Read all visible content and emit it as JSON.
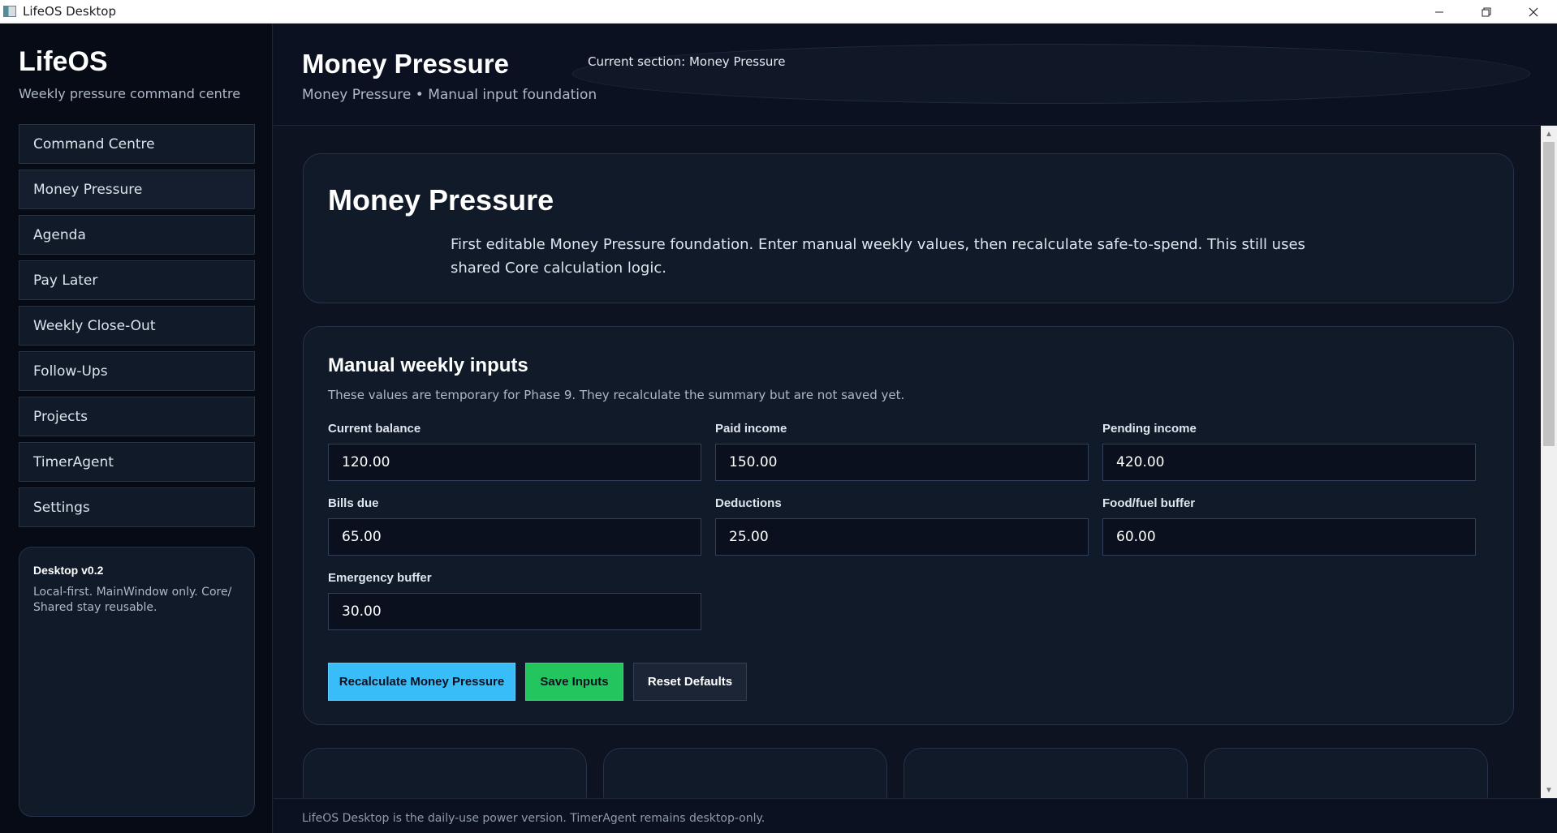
{
  "window": {
    "title": "LifeOS Desktop"
  },
  "sidebar": {
    "brand": "LifeOS",
    "tagline": "Weekly pressure command centre",
    "items": [
      {
        "label": "Command Centre"
      },
      {
        "label": "Money Pressure"
      },
      {
        "label": "Agenda"
      },
      {
        "label": "Pay Later"
      },
      {
        "label": "Weekly Close-Out"
      },
      {
        "label": "Follow-Ups"
      },
      {
        "label": "Projects"
      },
      {
        "label": "TimerAgent"
      },
      {
        "label": "Settings"
      }
    ],
    "active_item": "Money Pressure",
    "version": {
      "title": "Desktop v0.2",
      "text": "Local-first. MainWindow only. Core/ Shared stay reusable."
    }
  },
  "header": {
    "title": "Money Pressure",
    "subtitle": "Money Pressure • Manual input foundation",
    "current_section": "Current section: Money Pressure"
  },
  "hero": {
    "title": "Money Pressure",
    "description": "First editable Money Pressure foundation. Enter manual weekly values, then recalculate safe-to-spend. This still uses shared Core calculation logic."
  },
  "inputs": {
    "title": "Manual weekly inputs",
    "hint": "These values are temporary for Phase 9. They recalculate the summary but are not saved yet.",
    "fields": [
      {
        "label": "Current balance",
        "value": "120.00"
      },
      {
        "label": "Paid income",
        "value": "150.00"
      },
      {
        "label": "Pending income",
        "value": "420.00"
      },
      {
        "label": "Bills due",
        "value": "65.00"
      },
      {
        "label": "Deductions",
        "value": "25.00"
      },
      {
        "label": "Food/fuel buffer",
        "value": "60.00"
      },
      {
        "label": "Emergency buffer",
        "value": "30.00"
      }
    ],
    "buttons": {
      "recalculate": "Recalculate Money Pressure",
      "save": "Save Inputs",
      "reset": "Reset Defaults"
    }
  },
  "footer": {
    "text": "LifeOS Desktop is the daily-use power version. TimerAgent remains desktop-only."
  },
  "colors": {
    "accent_blue": "#38bdf8",
    "accent_green": "#22c55e",
    "background": "#0d1320",
    "sidebar_bg": "#070b16",
    "card_bg": "#111a29"
  }
}
